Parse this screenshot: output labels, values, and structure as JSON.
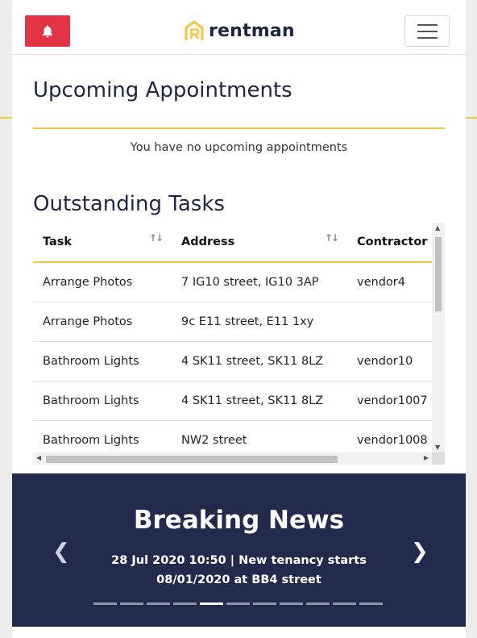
{
  "brand": {
    "logo_text": "rentman",
    "logo_color": "#f5c542"
  },
  "colors": {
    "accent": "#f5c542",
    "alert": "#e23245",
    "navy": "#232b4d"
  },
  "navbar": {
    "bell_icon": "bell-icon",
    "menu_icon": "hamburger-icon"
  },
  "appointments": {
    "title": "Upcoming Appointments",
    "empty_message": "You have no upcoming appointments"
  },
  "tasks": {
    "title": "Outstanding Tasks",
    "columns": [
      "Task",
      "Address",
      "Contractor"
    ],
    "rows": [
      [
        "Arrange Photos",
        "7 IG10 street, IG10 3AP",
        "vendor4"
      ],
      [
        "Arrange Photos",
        "9c E11 street, E11 1xy",
        ""
      ],
      [
        "Bathroom Lights",
        "4 SK11 street, SK11 8LZ",
        "vendor10"
      ],
      [
        "Bathroom Lights",
        "4 SK11 street, SK11 8LZ",
        "vendor1007"
      ],
      [
        "Bathroom Lights",
        "NW2 street",
        "vendor1008"
      ]
    ]
  },
  "news": {
    "title": "Breaking News",
    "text": "28 Jul 2020 10:50 | New tenancy starts 08/01/2020 at BB4 street",
    "indicator_count": 11,
    "active_index": 4
  }
}
